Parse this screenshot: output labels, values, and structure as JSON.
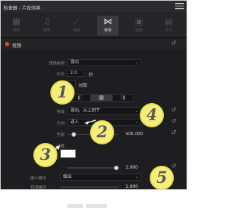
{
  "window": {
    "title": "检查器 - 片段效果"
  },
  "tabs": [
    {
      "label": "视频",
      "icon": "film-icon"
    },
    {
      "label": "音频",
      "icon": "music-note-icon"
    },
    {
      "label": "特效",
      "icon": "magic-wand-icon"
    },
    {
      "label": "转场",
      "icon": "bowtie-transition-icon",
      "active": true
    },
    {
      "label": "图像",
      "icon": "image-icon"
    },
    {
      "label": "文件",
      "icon": "file-icon"
    }
  ],
  "section": {
    "label": "视频"
  },
  "fields": {
    "transition_type": {
      "label": "转场类型",
      "value": "滑动"
    },
    "duration": {
      "label": "时长",
      "value": "2.0",
      "unit": "秒"
    },
    "frames_label": "帧数",
    "alignment": {
      "label": "对齐"
    },
    "preset": {
      "label": "预设",
      "value": "滑动，从上到下"
    },
    "direction": {
      "label": "方向",
      "value": "进入"
    },
    "color": {
      "label": "色彩",
      "value": "500.000"
    },
    "border": {
      "label": "边框"
    },
    "opacity": {
      "value": "1.000"
    },
    "ease": {
      "label": "缓入缓出",
      "value": "缓出"
    },
    "blend": {
      "label": "转场曲线",
      "value": "1.000"
    }
  },
  "badges": [
    "1",
    "2",
    "3",
    "4",
    "5"
  ],
  "colors": {
    "accent_dot": "#e6463a",
    "badge": "#f5ee7a"
  }
}
